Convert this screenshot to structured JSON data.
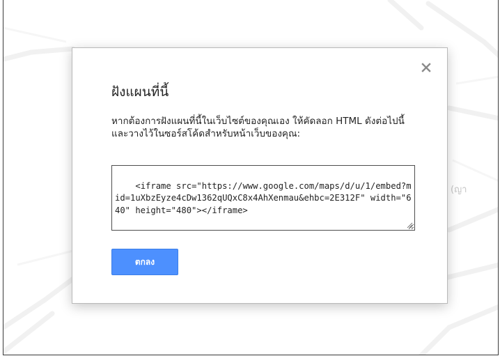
{
  "background": {
    "map_label": "(ญา"
  },
  "dialog": {
    "title": "ฝังแผนที่นี้",
    "instructions": "หากต้องการฝังแผนที่นี้ในเว็บไซต์ของคุณเอง ให้คัดลอก HTML ดังต่อไปนี้และวางไว้ในซอร์สโค้ดสำหรับหน้าเว็บของคุณ:",
    "embed_code": "<iframe src=\"https://www.google.com/maps/d/u/1/embed?mid=1uXbzEyze4cDw1362qUQxC8x4AhXenmau&ehbc=2E312F\" width=\"640\" height=\"480\"></iframe>",
    "ok_label": "ตกลง",
    "close_icon": "close-icon"
  },
  "colors": {
    "accent": "#4d90fe",
    "text": "#222222",
    "close_icon": "#8a8a8a"
  }
}
